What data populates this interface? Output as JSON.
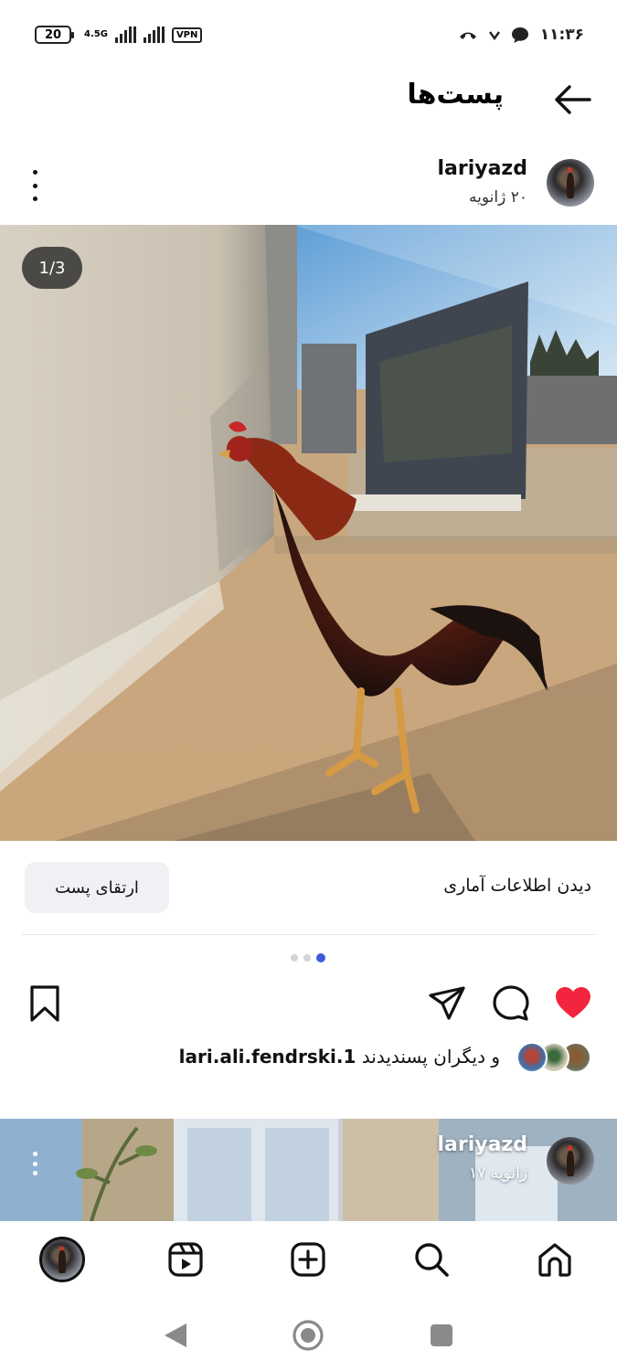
{
  "status_bar": {
    "battery": "20",
    "network": "4.5G",
    "vpn": "VPN",
    "time": "۱۱:۳۶"
  },
  "header": {
    "title": "پست‌ها"
  },
  "post": {
    "username": "lariyazd",
    "date": "۲۰ ژانویه",
    "image_counter": "1/3",
    "carousel": {
      "count": 3,
      "active_index": 3
    },
    "insights_link": "دیدن اطلاعات آماری",
    "boost_button": "ارتقای پست",
    "liked": true,
    "likes_prefix": "و دیگران پسندیدند",
    "likes_user": "lari.ali.fendrski.1"
  },
  "next_post": {
    "username": "lariyazd",
    "date": "۱۷ ژانویه"
  },
  "icons": {
    "back": "arrow-left-icon",
    "more": "more-vertical-icon",
    "like": "heart-icon",
    "comment": "comment-icon",
    "share": "send-icon",
    "save": "bookmark-icon",
    "nav": [
      "profile-avatar",
      "reels-icon",
      "create-icon",
      "search-icon",
      "home-icon"
    ]
  },
  "colors": {
    "like_red": "#f3243e",
    "carousel_active": "#3b5bdb",
    "button_bg": "#eff1f4"
  }
}
